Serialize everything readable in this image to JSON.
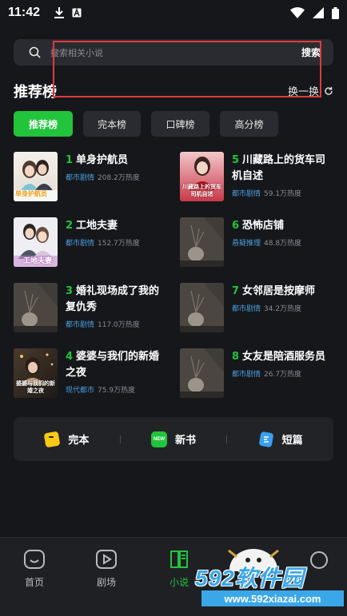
{
  "status_bar": {
    "time": "11:42"
  },
  "search": {
    "placeholder": "搜索相关小说",
    "button": "搜索"
  },
  "section": {
    "title": "推荐榜",
    "refresh_label": "换一换"
  },
  "tabs": [
    {
      "label": "推荐榜",
      "active": true
    },
    {
      "label": "完本榜",
      "active": false
    },
    {
      "label": "口碑榜",
      "active": false
    },
    {
      "label": "高分榜",
      "active": false
    }
  ],
  "books": [
    {
      "rank": "1",
      "title": "单身护航员",
      "tag": "都市剧情",
      "heat": "208.2万热度",
      "cover_text": "单身护航员"
    },
    {
      "rank": "5",
      "title": "川藏路上的货车司机自述",
      "tag": "都市剧情",
      "heat": "59.1万热度",
      "cover_text": "川藏路上的货车司机自述"
    },
    {
      "rank": "2",
      "title": "工地夫妻",
      "tag": "都市剧情",
      "heat": "152.7万热度",
      "cover_text": "工地夫妻"
    },
    {
      "rank": "6",
      "title": "恐怖店铺",
      "tag": "悬疑推理",
      "heat": "48.8万热度"
    },
    {
      "rank": "3",
      "title": "婚礼现场成了我的复仇秀",
      "tag": "都市剧情",
      "heat": "117.0万热度"
    },
    {
      "rank": "7",
      "title": "女邻居是按摩师",
      "tag": "都市剧情",
      "heat": "34.2万热度"
    },
    {
      "rank": "4",
      "title": "婆婆与我们的新婚之夜",
      "tag": "现代都市",
      "heat": "75.9万热度",
      "cover_text": "婆婆与我们的新婚之夜"
    },
    {
      "rank": "8",
      "title": "女友是陪酒服务员",
      "tag": "都市剧情",
      "heat": "26.7万热度"
    }
  ],
  "quick_links": [
    {
      "label": "完本",
      "icon": "book-bookmark-icon"
    },
    {
      "label": "新书",
      "icon": "new-badge-icon",
      "badge": "NEW"
    },
    {
      "label": "短篇",
      "icon": "short-story-icon"
    }
  ],
  "nav": [
    {
      "label": "首页",
      "icon": "home-icon"
    },
    {
      "label": "剧场",
      "icon": "play-icon"
    },
    {
      "label": "小说",
      "icon": "book-icon",
      "active": true
    }
  ],
  "watermark": {
    "big": "592软件园",
    "small": "www.592xiazai.com"
  },
  "colors": {
    "accent": "#22c43c",
    "tag": "#4a9edc",
    "background": "#16171b",
    "highlight": "#e03b3b"
  }
}
